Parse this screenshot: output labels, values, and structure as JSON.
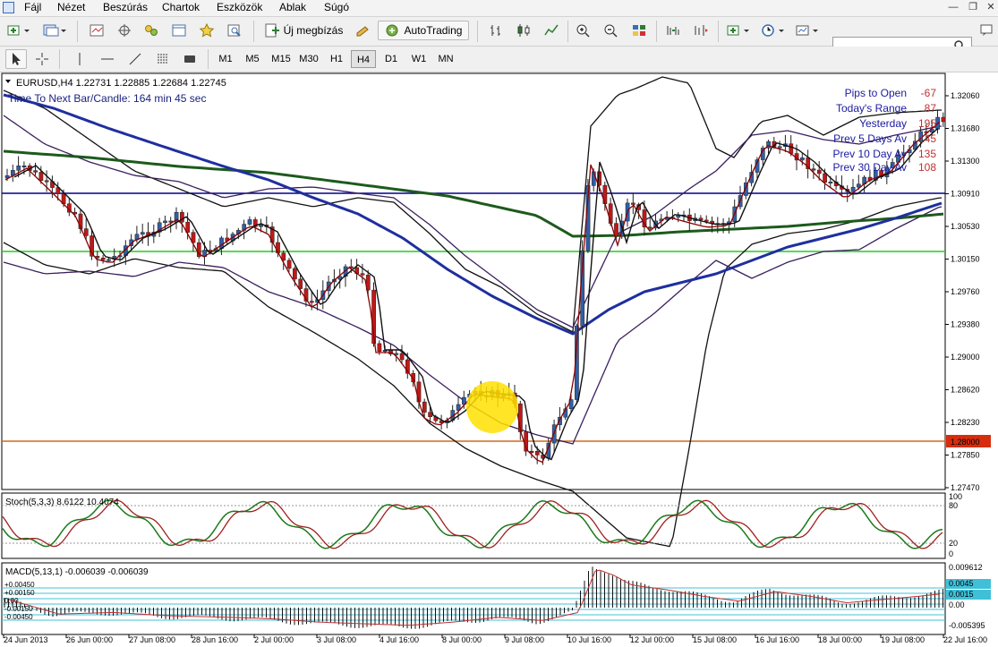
{
  "menu": {
    "items": [
      "Fájl",
      "Nézet",
      "Beszúrás",
      "Chartok",
      "Eszközök",
      "Ablak",
      "Súgó"
    ]
  },
  "toolbar": {
    "new_order_label": "Új megbízás",
    "autotrading_label": "AutoTrading",
    "search_placeholder": "",
    "timeframes": [
      "M1",
      "M5",
      "M15",
      "M30",
      "H1",
      "H4",
      "D1",
      "W1",
      "MN"
    ],
    "active_timeframe": "H4"
  },
  "chart": {
    "header": "EURUSD,H4  1.22731 1.22885 1.22684 1.22745",
    "timer_text": "Time To Next Bar/Candle: 164 min 45 sec",
    "price_labels": [
      "1.32060",
      "1.31680",
      "1.31300",
      "1.30910",
      "1.30530",
      "1.30150",
      "1.29760",
      "1.29380",
      "1.29000",
      "1.28620",
      "1.28230",
      "1.27850",
      "1.27470"
    ],
    "horizontal_line_price": "1.28000",
    "stats": [
      {
        "label": "Pips to Open",
        "value": "-67"
      },
      {
        "label": "Today's Range",
        "value": "87"
      },
      {
        "label": "Yesterday",
        "value": "195"
      },
      {
        "label": "Prev 5 Days Av",
        "value": "145"
      },
      {
        "label": "Prev 10 Day Av",
        "value": "135"
      },
      {
        "label": "Prev 30 Day Av",
        "value": "108"
      }
    ],
    "date_labels": [
      "24 Jun 2013",
      "26 Jun 00:00",
      "27 Jun 08:00",
      "28 Jun 16:00",
      "2 Jul 00:00",
      "3 Jul 08:00",
      "4 Jul 16:00",
      "8 Jul 00:00",
      "9 Jul 08:00",
      "10 Jul 16:00",
      "12 Jul 00:00",
      "15 Jul 08:00",
      "16 Jul 16:00",
      "18 Jul 00:00",
      "19 Jul 08:00",
      "22 Jul 16:00"
    ],
    "colors": {
      "up": "#2f5fa8",
      "down": "#c01818",
      "highlight": "#ffe000"
    }
  },
  "stoch": {
    "header": "Stoch(5,3,3) 8.6122 10.4074",
    "levels": [
      "100",
      "80",
      "20",
      "0"
    ]
  },
  "macd": {
    "header": "MACD(5,13,1) -0.006039 -0.006039",
    "right_labels": [
      "0.009612",
      "0.0045",
      "0.0015",
      "0.00",
      "-0.005395"
    ],
    "left_labels": [
      "+0.00450",
      "+0.00150",
      "0.00",
      "-0.00150",
      "-0.00450"
    ]
  }
}
